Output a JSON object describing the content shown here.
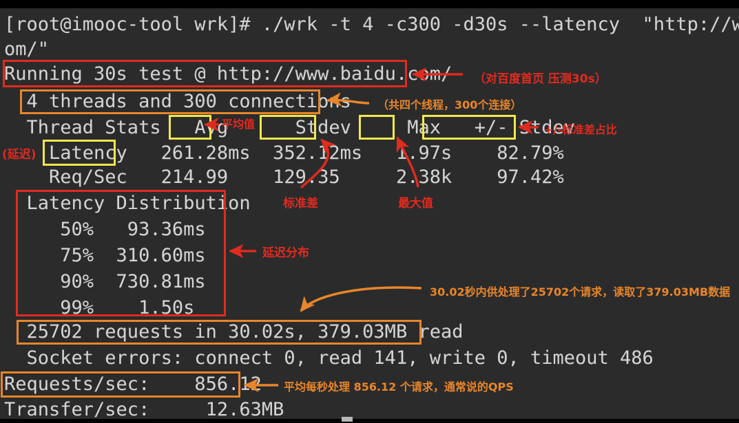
{
  "terminal": {
    "background_color": "#2b2b2b",
    "text_color": "#d4d4d4",
    "lines": [
      {
        "text": "[root@imooc-tool wrk]# ./wrk -t 4 -c300 -d30s --latency  \"http://www.baidu."
      },
      {
        "text": "om/\""
      },
      {
        "text": "Running 30s test @ http://www.baidu.com/"
      },
      {
        "text": "  4 threads and 300 connections"
      },
      {
        "text": "  Thread Stats   Avg      Stdev     Max   +/- Stdev"
      },
      {
        "text": "    Latency   261.28ms  352.12ms   1.97s    82.79%"
      },
      {
        "text": "    Req/Sec   214.99    129.35     2.38k    97.42%"
      },
      {
        "text": "  Latency Distribution"
      },
      {
        "text": "     50%   93.36ms"
      },
      {
        "text": "     75%  310.60ms"
      },
      {
        "text": "     90%  730.81ms"
      },
      {
        "text": "     99%    1.50s"
      },
      {
        "text": "  25702 requests in 30.02s, 379.03MB read"
      },
      {
        "text": "  Socket errors: connect 0, read 141, write 0, timeout 486"
      },
      {
        "text": "Requests/sec:    856.12"
      },
      {
        "text": "Transfer/sec:     12.63MB"
      }
    ],
    "command": {
      "prompt": "[root@imooc-tool wrk]#",
      "program": "./wrk",
      "threads_flag": "-t 4",
      "connections_flag": "-c300",
      "duration_flag": "-d30s",
      "latency_flag": "--latency",
      "url": "\"http://www.baidu.com/\""
    },
    "summary": {
      "running_line": "Running 30s test @ http://www.baidu.com/",
      "threads_line": "4 threads and 300 connections",
      "requests_line": "25702 requests in 30.02s, 379.03MB read",
      "socket_errors_line": "Socket errors: connect 0, read 141, write 0, timeout 486",
      "requests_per_sec_label": "Requests/sec:",
      "requests_per_sec_value": "856.12",
      "transfer_per_sec_label": "Transfer/sec:",
      "transfer_per_sec_value": "12.63MB"
    },
    "thread_stats": {
      "title": "Thread Stats",
      "headers": [
        "Avg",
        "Stdev",
        "Max",
        "+/- Stdev"
      ],
      "rows": [
        {
          "label": "Latency",
          "avg": "261.28ms",
          "stdev": "352.12ms",
          "max": "1.97s",
          "pm_stdev": "82.79%"
        },
        {
          "label": "Req/Sec",
          "avg": "214.99",
          "stdev": "129.35",
          "max": "2.38k",
          "pm_stdev": "97.42%"
        }
      ]
    },
    "latency_distribution": {
      "title": "Latency Distribution",
      "rows": [
        {
          "percentile": "50%",
          "value": "93.36ms"
        },
        {
          "percentile": "75%",
          "value": "310.60ms"
        },
        {
          "percentile": "90%",
          "value": "730.81ms"
        },
        {
          "percentile": "99%",
          "value": "1.50s"
        }
      ]
    }
  },
  "annotations": {
    "colors": {
      "red": "#e02b20",
      "orange": "#e8862a",
      "yellow": "#f2e84c"
    },
    "notes": [
      {
        "id": "running-note",
        "text": "（对百度首页 压测30s）",
        "color": "#e02b20"
      },
      {
        "id": "threads-note",
        "text": "（共四个线程，300个连接）",
        "color": "#e8862a"
      },
      {
        "id": "avg-note",
        "text": "平均值",
        "color": "#e02b20"
      },
      {
        "id": "stdev-note",
        "text": "标准差",
        "color": "#e02b20"
      },
      {
        "id": "max-note",
        "text": "最大值",
        "color": "#e02b20"
      },
      {
        "id": "pm-stdev-note",
        "text": "+/-标准差占比",
        "color": "#e02b20"
      },
      {
        "id": "latency-note",
        "text": "(延迟)",
        "color": "#e02b20"
      },
      {
        "id": "distribution-note",
        "text": "延迟分布",
        "color": "#e02b20"
      },
      {
        "id": "requests-note",
        "text": "30.02秒内供处理了25702个请求，读取了379.03MB数据",
        "color": "#e8862a"
      },
      {
        "id": "qps-note",
        "text": "平均每秒处理 856.12 个请求，通常说的QPS",
        "color": "#e8862a"
      }
    ]
  }
}
